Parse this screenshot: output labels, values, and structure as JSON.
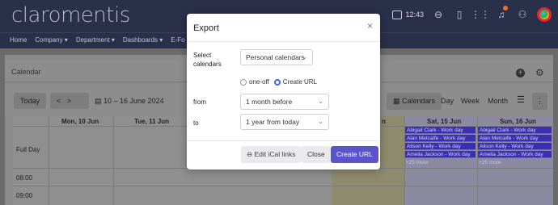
{
  "app": {
    "logo": "claromentis",
    "time": "12:43",
    "nav": [
      "Home",
      "Company ▾",
      "Department ▾",
      "Dashboards ▾",
      "E-Fo"
    ]
  },
  "calendar": {
    "title": "Calendar",
    "today": "Today",
    "date_range": "10 – 16 June 2024",
    "view_buttons": [
      "Calendars",
      "Day",
      "Week",
      "Month"
    ],
    "columns": [
      "Mon, 10 Jun",
      "Tue, 11 Jun",
      "Sat, 15 Jun",
      "Sun, 16 Jun"
    ],
    "partial_col": "n",
    "rows": [
      "Full Day",
      "08:00",
      "09:00"
    ],
    "sat_events": [
      "Abigail Clark - Work day",
      "Alan Metcalfe - Work day",
      "Alison Kelly - Work day",
      "Amelia Jackson - Work day"
    ],
    "sun_events": [
      "Abigail Clark - Work day",
      "Alan Metcalfe - Work day",
      "Alison Kelly - Work day",
      "Amelia Jackson - Work day"
    ],
    "sat_more": "+25 more",
    "sun_more": "+25 more"
  },
  "modal": {
    "title": "Export",
    "close": "×",
    "select_label": "Select calendars",
    "select_value": "Personal calendars",
    "radio_oneoff": "one-off",
    "radio_create": "Create URL",
    "from_label": "from",
    "from_value": "1 month before",
    "to_label": "to",
    "to_value": "1 year from today",
    "edit_btn": "Edit iCal links",
    "close_btn": "Close",
    "create_btn": "Create URL"
  }
}
